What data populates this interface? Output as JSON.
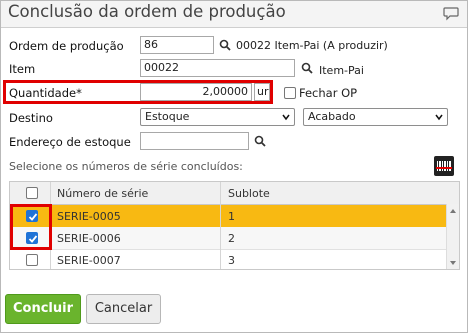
{
  "dialog": {
    "title": "Conclusão da ordem de produção"
  },
  "form": {
    "ordem_label": "Ordem de produção",
    "ordem_value": "86",
    "ordem_desc": "00022 Item-Pai (A produzir)",
    "item_label": "Item",
    "item_value": "00022",
    "item_desc": "Item-Pai",
    "quantidade_label": "Quantidade*",
    "quantidade_value": "2,00000",
    "quantidade_unit": "ur",
    "fechar_op_label": "Fechar OP",
    "destino_label": "Destino",
    "destino_value": "Estoque",
    "destino2_value": "Acabado",
    "endereco_label": "Endereço de estoque",
    "endereco_value": "",
    "serie_prompt": "Selecione os números de série concluídos:"
  },
  "grid": {
    "columns": [
      "Número de série",
      "Sublote"
    ],
    "rows": [
      {
        "serie": "SERIE-0005",
        "sublote": "1",
        "checked": true,
        "selected": true
      },
      {
        "serie": "SERIE-0006",
        "sublote": "2",
        "checked": true,
        "selected": false
      },
      {
        "serie": "SERIE-0007",
        "sublote": "3",
        "checked": false,
        "selected": false
      }
    ]
  },
  "buttons": {
    "concluir": "Concluir",
    "cancelar": "Cancelar"
  },
  "colors": {
    "selected_row": "#f8b912",
    "highlight_border": "#e00000",
    "primary_button": "#6ab42d",
    "checkbox_checked": "#1f73d6"
  }
}
